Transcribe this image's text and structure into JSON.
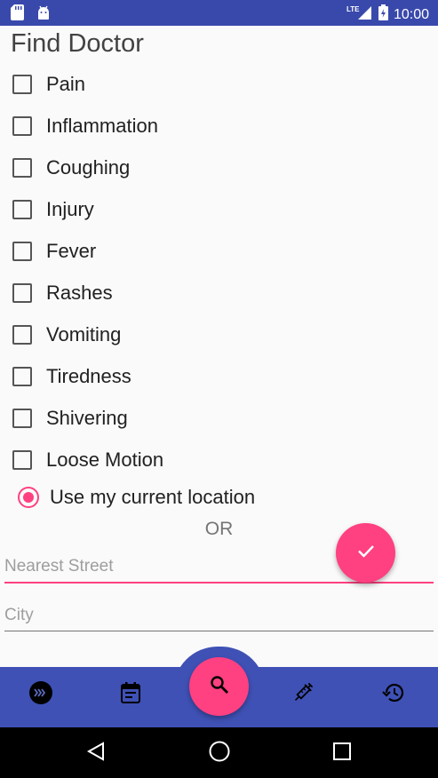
{
  "status_bar": {
    "time": "10:00",
    "network": "LTE",
    "left_icons": [
      "sd-card-icon",
      "android-icon"
    ]
  },
  "page": {
    "title": "Find Doctor"
  },
  "symptoms": [
    {
      "label": "Pain",
      "checked": false
    },
    {
      "label": "Inflammation",
      "checked": false
    },
    {
      "label": "Coughing",
      "checked": false
    },
    {
      "label": "Injury",
      "checked": false
    },
    {
      "label": "Fever",
      "checked": false
    },
    {
      "label": "Rashes",
      "checked": false
    },
    {
      "label": "Vomiting",
      "checked": false
    },
    {
      "label": "Tiredness",
      "checked": false
    },
    {
      "label": "Shivering",
      "checked": false
    },
    {
      "label": "Loose Motion",
      "checked": false
    }
  ],
  "location": {
    "use_current_label": "Use my current location",
    "use_current_selected": true,
    "or_label": "OR",
    "street_placeholder": "Nearest Street",
    "street_value": "",
    "city_placeholder": "City",
    "city_value": ""
  },
  "actions": {
    "confirm_icon": "check-icon"
  },
  "bottom_nav": {
    "items": [
      "forward-circle-icon",
      "calendar-icon",
      "search-icon",
      "syringe-icon",
      "history-icon"
    ],
    "active": "search-icon"
  },
  "colors": {
    "primary": "#3f51b5",
    "primary_dark": "#3949ab",
    "accent": "#ff4081",
    "background": "#fafafa"
  }
}
